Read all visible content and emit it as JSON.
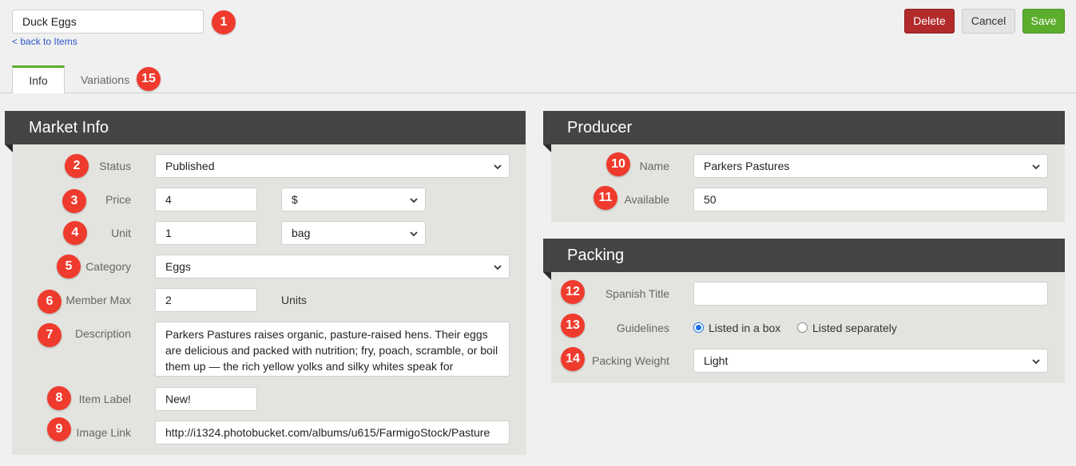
{
  "header": {
    "item_name_value": "Duck Eggs",
    "back_link": "< back to Items",
    "delete_label": "Delete",
    "cancel_label": "Cancel",
    "save_label": "Save"
  },
  "tabs": [
    {
      "label": "Info",
      "active": true
    },
    {
      "label": "Variations",
      "active": false
    }
  ],
  "badges": [
    "1",
    "2",
    "3",
    "4",
    "5",
    "6",
    "7",
    "8",
    "9",
    "10",
    "11",
    "12",
    "13",
    "14",
    "15"
  ],
  "market_info": {
    "title": "Market Info",
    "status": {
      "label": "Status",
      "value": "Published"
    },
    "price": {
      "label": "Price",
      "value": "4",
      "currency": "$"
    },
    "unit": {
      "label": "Unit",
      "value": "1",
      "unit_type": "bag"
    },
    "category": {
      "label": "Category",
      "value": "Eggs"
    },
    "member_max": {
      "label": "Member Max",
      "value": "2",
      "suffix": "Units"
    },
    "description": {
      "label": "Description",
      "value": "Parkers Pastures raises organic, pasture-raised hens. Their eggs are delicious and packed with nutrition; fry, poach, scramble, or boil them up — the rich yellow yolks and silky whites speak for"
    },
    "item_label": {
      "label": "Item Label",
      "value": "New!"
    },
    "image_link": {
      "label": "Image Link",
      "value": "http://i1324.photobucket.com/albums/u615/FarmigoStock/Pasture"
    }
  },
  "producer": {
    "title": "Producer",
    "name": {
      "label": "Name",
      "value": "Parkers Pastures"
    },
    "available": {
      "label": "Available",
      "value": "50"
    }
  },
  "packing": {
    "title": "Packing",
    "spanish_title": {
      "label": "Spanish Title",
      "value": ""
    },
    "guidelines": {
      "label": "Guidelines",
      "option_box": "Listed in a box",
      "option_separate": "Listed separately",
      "selected": "box"
    },
    "packing_weight": {
      "label": "Packing Weight",
      "value": "Light"
    }
  },
  "colors": {
    "delete": "#b22a2a",
    "save": "#5bad2b",
    "badge": "#ef3b2d",
    "panel_header": "#444444",
    "tab_accent": "#5bad2b",
    "link": "#2a56c6"
  }
}
